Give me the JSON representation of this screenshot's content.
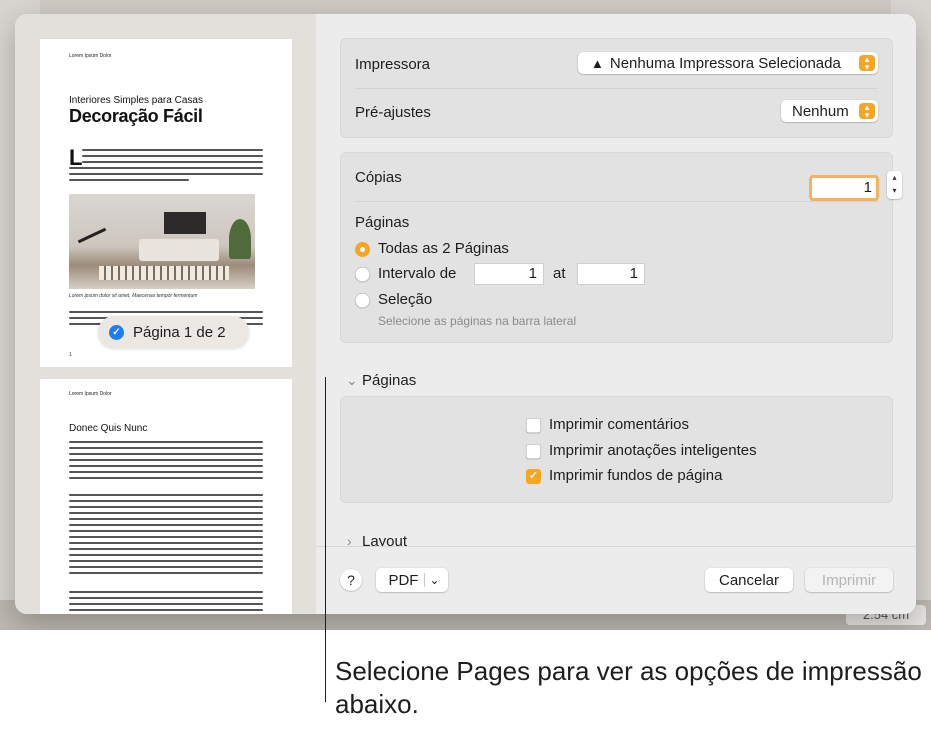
{
  "sidebar": {
    "page1": {
      "header": "Lorem Ipsum Dolor",
      "subtitle": "Interiores Simples para Casas",
      "title": "Decoração Fácil",
      "dropcap": "L",
      "caption": "Lorem ipsum dolor sit amet, Maecenas tempor fermentum",
      "page_number": "1"
    },
    "page2": {
      "header": "Lorem Ipsum Dolor",
      "title": "Donec Quis Nunc"
    },
    "page_badge": {
      "label": "Página 1 de 2",
      "checked": true
    }
  },
  "printer": {
    "label": "Impressora",
    "value": "Nenhuma Impressora Selecionada",
    "warning_icon": "warning-triangle-icon"
  },
  "presets": {
    "label": "Pré-ajustes",
    "value": "Nenhum"
  },
  "copies": {
    "label": "Cópias",
    "value": "1"
  },
  "pages": {
    "label": "Páginas",
    "options": {
      "all": "Todas as 2 Páginas",
      "range": "Intervalo de",
      "range_from": "1",
      "range_to_label": "at",
      "range_to": "1",
      "selection": "Seleção",
      "selection_hint": "Selecione as páginas na barra lateral"
    },
    "selected": "all"
  },
  "pages_section": {
    "title": "Páginas",
    "options": [
      {
        "label": "Imprimir comentários",
        "checked": false
      },
      {
        "label": "Imprimir anotações inteligentes",
        "checked": false
      },
      {
        "label": "Imprimir fundos de página",
        "checked": true
      }
    ]
  },
  "layout_section": {
    "title": "Layout"
  },
  "footer": {
    "help_label": "?",
    "pdf_label": "PDF",
    "cancel_label": "Cancelar",
    "print_label": "Imprimir"
  },
  "background": {
    "ruler_value": "2.54 cm"
  },
  "callout": {
    "text": "Selecione Pages para ver as opções de impressão abaixo."
  },
  "colors": {
    "accent": "#f5a623",
    "selection_blue": "#1f7cf3",
    "dialog_bg": "#ececec",
    "sidebar_bg": "#e3e0dc"
  }
}
